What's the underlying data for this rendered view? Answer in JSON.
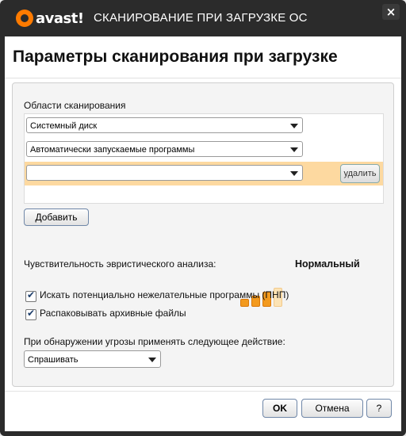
{
  "window": {
    "brand": "avast!",
    "title": "СКАНИРОВАНИЕ ПРИ ЗАГРУЗКЕ ОС",
    "close_label": "×"
  },
  "heading": "Параметры сканирования при загрузке",
  "scan_areas": {
    "label": "Области сканирования",
    "items": [
      {
        "value": "Системный диск"
      },
      {
        "value": "Автоматически запускаемые программы"
      },
      {
        "value": ""
      }
    ],
    "delete_label": "удалить",
    "add_label": "Добавить"
  },
  "sensitivity": {
    "label": "Чувствительность эвристического анализа:",
    "level_value": "Нормальный",
    "level_index": 3,
    "level_max": 4,
    "colors": {
      "on": "#f39a1e",
      "off": "#fce3b5"
    }
  },
  "options": [
    {
      "label": "Искать потенциально нежелательные программы (ПНП)",
      "checked": true
    },
    {
      "label": "Распаковывать архивные файлы",
      "checked": true
    }
  ],
  "action": {
    "label": "При обнаружении угрозы применять следующее действие:",
    "value": "Спрашивать"
  },
  "footer": {
    "ok_label": "OK",
    "cancel_label": "Отмена",
    "help_label": "?"
  }
}
